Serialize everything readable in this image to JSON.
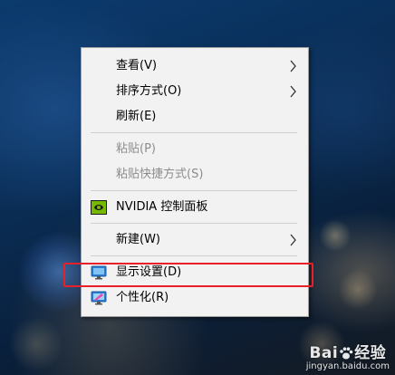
{
  "context_menu": {
    "items": [
      {
        "label": "查看(V)",
        "has_submenu": true,
        "enabled": true
      },
      {
        "label": "排序方式(O)",
        "has_submenu": true,
        "enabled": true
      },
      {
        "label": "刷新(E)",
        "has_submenu": false,
        "enabled": true
      },
      {
        "label": "粘贴(P)",
        "has_submenu": false,
        "enabled": false
      },
      {
        "label": "粘贴快捷方式(S)",
        "has_submenu": false,
        "enabled": false
      },
      {
        "label": "NVIDIA 控制面板",
        "icon": "nvidia-icon",
        "has_submenu": false,
        "enabled": true
      },
      {
        "label": "新建(W)",
        "has_submenu": true,
        "enabled": true
      },
      {
        "label": "显示设置(D)",
        "icon": "monitor-icon",
        "has_submenu": false,
        "enabled": true,
        "highlighted": true
      },
      {
        "label": "个性化(R)",
        "icon": "personalize-icon",
        "has_submenu": false,
        "enabled": true
      }
    ]
  },
  "watermark": {
    "brand_left": "Bai",
    "brand_right": "经验",
    "url": "jingyan.baidu.com"
  },
  "colors": {
    "highlight_box": "#e8202a",
    "menu_background": "#f2f2f2",
    "disabled_text": "#8c8c8c",
    "nvidia_green": "#76b900"
  }
}
